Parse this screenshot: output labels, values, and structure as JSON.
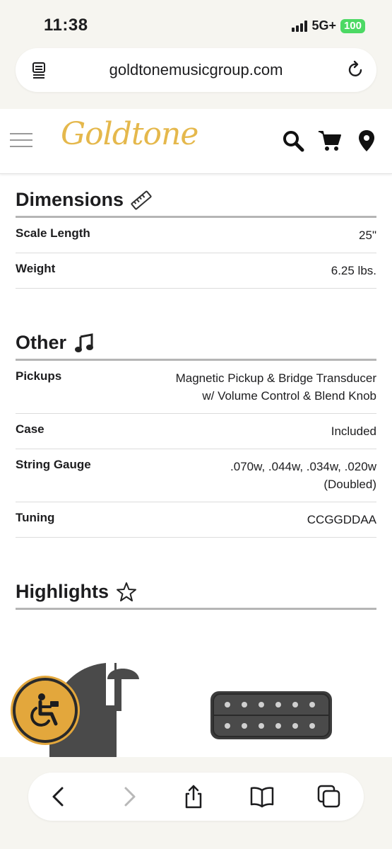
{
  "status": {
    "time": "11:38",
    "network": "5G+",
    "battery": "100"
  },
  "browser": {
    "url": "goldtonemusicgroup.com"
  },
  "site": {
    "logo_text": "Goldtone"
  },
  "sections": {
    "dimensions": {
      "title": "Dimensions",
      "rows": [
        {
          "label": "Scale Length",
          "value": "25\""
        },
        {
          "label": "Weight",
          "value": "6.25 lbs."
        }
      ]
    },
    "other": {
      "title": "Other",
      "rows": [
        {
          "label": "Pickups",
          "value": "Magnetic Pickup & Bridge Transducer w/ Volume Control & Blend Knob"
        },
        {
          "label": "Case",
          "value": "Included"
        },
        {
          "label": "String Gauge",
          "value": ".070w, .044w, .034w, .020w (Doubled)"
        },
        {
          "label": "Tuning",
          "value": "CCGGDDAA"
        }
      ]
    },
    "highlights": {
      "title": "Highlights"
    }
  },
  "icons": {
    "reader": "reader-mode-icon",
    "reload": "reload-icon",
    "menu": "hamburger-menu-icon",
    "search": "search-icon",
    "cart": "cart-icon",
    "location": "location-pin-icon",
    "ruler": "ruler-icon",
    "music": "music-note-icon",
    "star": "star-icon",
    "accessibility": "accessibility-icon",
    "back": "back-arrow-icon",
    "forward": "forward-arrow-icon",
    "share": "share-icon",
    "bookmarks": "bookmarks-icon",
    "tabs": "tabs-icon"
  },
  "colors": {
    "brand_gold": "#e5b84c",
    "accessibility_bg": "#e3a73c",
    "divider": "#b5b5b5"
  }
}
